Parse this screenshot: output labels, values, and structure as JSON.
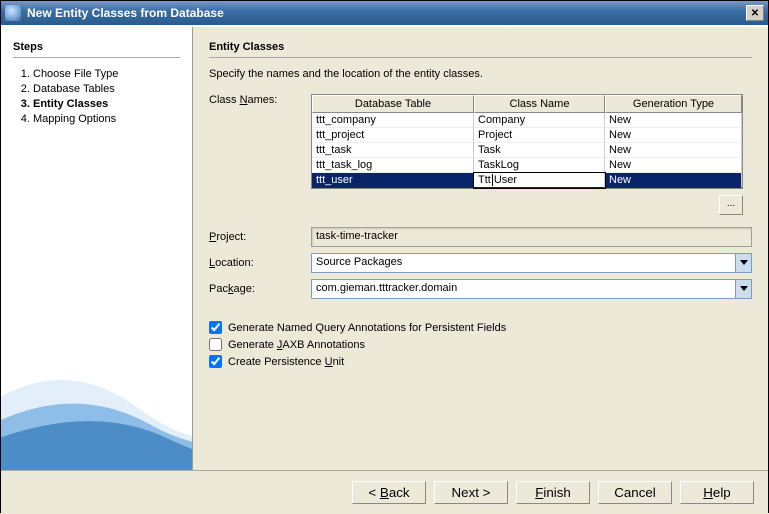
{
  "window": {
    "title": "New Entity Classes from Database"
  },
  "sidebar": {
    "heading": "Steps",
    "items": [
      {
        "label": "Choose File Type"
      },
      {
        "label": "Database Tables"
      },
      {
        "label": "Entity Classes",
        "current": true
      },
      {
        "label": "Mapping Options"
      }
    ]
  },
  "main": {
    "heading": "Entity Classes",
    "description": "Specify the names and the location of the entity classes.",
    "class_names_label": "Class Names:",
    "table_headers": {
      "col1": "Database Table",
      "col2": "Class Name",
      "col3": "Generation Type"
    },
    "rows": [
      {
        "db": "ttt_company",
        "cls": "Company",
        "gen": "New"
      },
      {
        "db": "ttt_project",
        "cls": "Project",
        "gen": "New"
      },
      {
        "db": "ttt_task",
        "cls": "Task",
        "gen": "New"
      },
      {
        "db": "ttt_task_log",
        "cls": "TaskLog",
        "gen": "New"
      },
      {
        "db": "ttt_user",
        "cls_left": "Ttt",
        "cls_right": "User",
        "gen": "New",
        "selected": true
      }
    ],
    "more_button": "...",
    "project_label": "Project:",
    "project_value": "task-time-tracker",
    "location_label": "Location:",
    "location_value": "Source Packages",
    "package_label": "Package:",
    "package_value": "com.gieman.tttracker.domain",
    "checkboxes": {
      "named_query": "Generate Named Query Annotations for Persistent Fields",
      "jaxb": "Generate JAXB Annotations",
      "persistence_unit": "Create Persistence Unit"
    }
  },
  "buttons": {
    "back": "< Back",
    "next": "Next >",
    "finish": "Finish",
    "cancel": "Cancel",
    "help": "Help"
  }
}
